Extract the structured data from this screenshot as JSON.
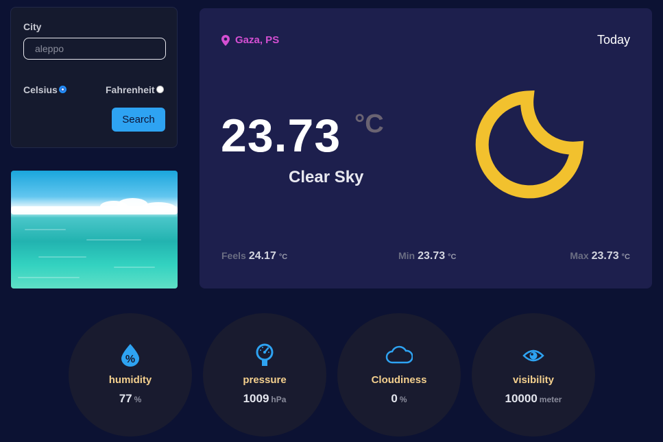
{
  "search": {
    "city_label": "City",
    "city_value": "aleppo",
    "celsius_label": "Celsius",
    "fahrenheit_label": "Fahrenheit",
    "selected_unit": "Celsius",
    "search_button": "Search"
  },
  "weather": {
    "location": "Gaza, PS",
    "day_label": "Today",
    "temperature": "23.73",
    "temperature_unit": "°C",
    "condition": "Clear Sky",
    "condition_icon": "crescent-moon-icon",
    "feels_label": "Feels",
    "feels_value": "24.17",
    "feels_unit": "°C",
    "min_label": "Min",
    "min_value": "23.73",
    "min_unit": "°C",
    "max_label": "Max",
    "max_value": "23.73",
    "max_unit": "°C"
  },
  "metrics": [
    {
      "icon": "humidity-drop-icon",
      "label": "humidity",
      "value": "77",
      "unit": "%"
    },
    {
      "icon": "pressure-gauge-icon",
      "label": "pressure",
      "value": "1009",
      "unit": "hPa"
    },
    {
      "icon": "cloud-icon",
      "label": "Cloudiness",
      "value": "0",
      "unit": "%"
    },
    {
      "icon": "eye-icon",
      "label": "visibility",
      "value": "10000",
      "unit": "meter"
    }
  ],
  "colors": {
    "background": "#0c1233",
    "card": "#1d1f4d",
    "accent_blue": "#2ea3f2",
    "location_pink": "#d44fd2",
    "moon_yellow": "#f2c12e",
    "metric_label": "#f4d08e"
  }
}
